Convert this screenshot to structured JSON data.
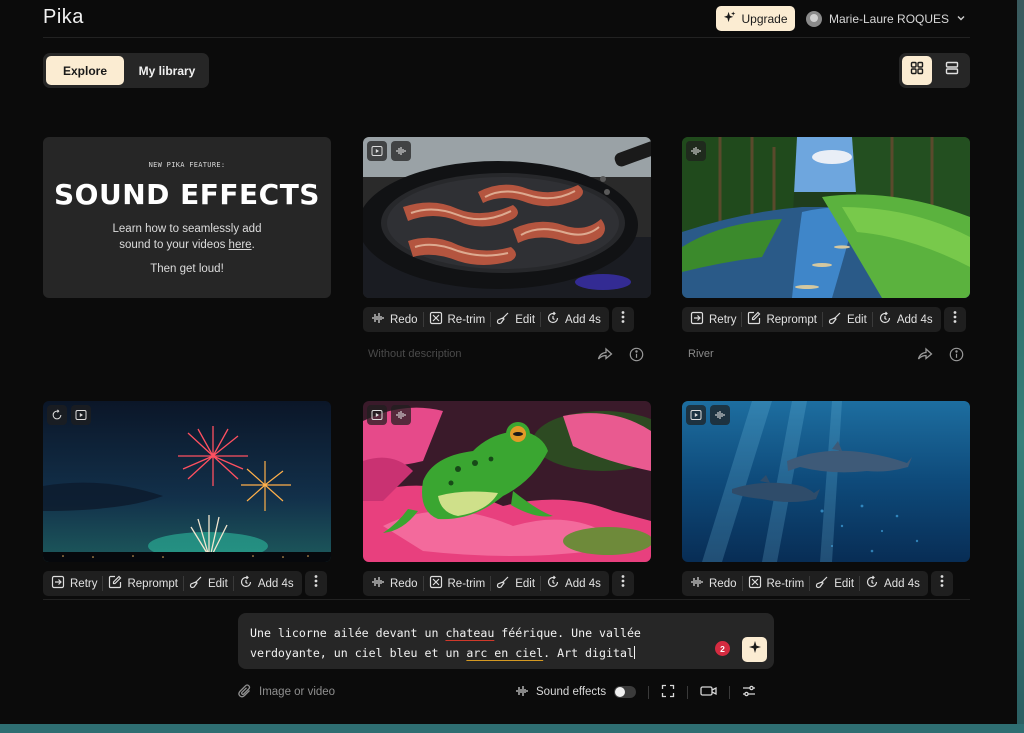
{
  "app": {
    "logo": "Pika"
  },
  "header": {
    "upgrade_label": "Upgrade",
    "user_name": "Marie-Laure ROQUES"
  },
  "tabs": [
    {
      "label": "Explore",
      "active": true
    },
    {
      "label": "My library",
      "active": false
    }
  ],
  "view_toggle": {
    "options": [
      "grid-icon",
      "list-icon"
    ],
    "selected": "grid-icon"
  },
  "promo": {
    "tag": "NEW PIKA FEATURE:",
    "title": "SOUND EFFECTS",
    "line1": "Learn how to seamlessly add",
    "line2_pre": "sound to your videos ",
    "line2_link": "here",
    "line2_post": ".",
    "line3": "Then get loud!"
  },
  "cards": [
    {
      "image": "bacon-in-pan",
      "badges": [
        "play-icon",
        "waveform-icon"
      ],
      "actions": [
        "Redo",
        "Re-trim",
        "Edit",
        "Add 4s"
      ],
      "description": "Without description"
    },
    {
      "image": "forest-river",
      "badges": [
        "waveform-icon"
      ],
      "actions": [
        "Retry",
        "Reprompt",
        "Edit",
        "Add 4s"
      ],
      "description": "River"
    },
    {
      "image": "fireworks-night",
      "badges": [
        "extend-icon",
        "play-icon"
      ],
      "actions": [
        "Retry",
        "Reprompt",
        "Edit",
        "Add 4s"
      ]
    },
    {
      "image": "frog-on-lotus",
      "badges": [
        "play-icon",
        "waveform-icon"
      ],
      "actions": [
        "Redo",
        "Re-trim",
        "Edit",
        "Add 4s"
      ]
    },
    {
      "image": "underwater-dolphins",
      "badges": [
        "play-icon",
        "waveform-icon"
      ],
      "actions": [
        "Redo",
        "Re-trim",
        "Edit",
        "Add 4s"
      ]
    }
  ],
  "prompt": {
    "seg1": "Une licorne ailée devant un ",
    "seg2": "chateau",
    "seg3": " féérique. Une vallée verdoyante, un ciel bleu et un ",
    "seg4": "arc en ciel",
    "seg5": ". Art digital",
    "issue_count": "2"
  },
  "toolbar": {
    "attach_label": "Image or video",
    "sound_effects_label": "Sound effects",
    "sound_effects_on": false
  }
}
